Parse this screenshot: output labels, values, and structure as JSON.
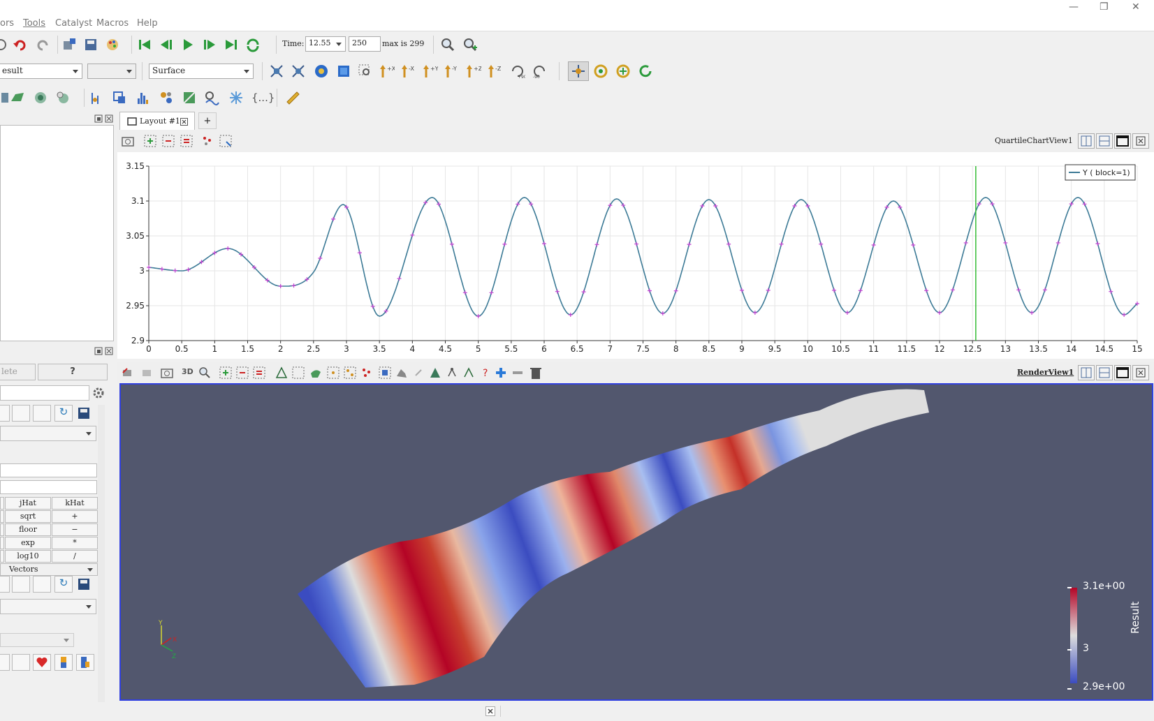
{
  "menubar": {
    "items": [
      {
        "label": "ors",
        "u": ""
      },
      {
        "label": "Tools",
        "u": "T"
      },
      {
        "label": "Catalyst",
        "u": "C"
      },
      {
        "label": "Macros",
        "u": "M"
      },
      {
        "label": "Help",
        "u": "H"
      }
    ],
    "window_controls": [
      "—",
      "❐",
      "✕"
    ]
  },
  "time_toolbar": {
    "time_label": "Time:",
    "time_value": "12.55",
    "step_value": "250",
    "max_label": "max is 299"
  },
  "representation_toolbar": {
    "array_combo": "esult",
    "component_combo": "",
    "representation": "Surface"
  },
  "layout_tab": {
    "label": "Layout #1",
    "add_label": "+"
  },
  "chart_view": {
    "name": "QuartileChartView1",
    "legend": "Y ( block=1)",
    "line_color": "#3c7a96",
    "marker_color": "#c040d0",
    "time_marker_color": "#33bb33",
    "time_marker_x": 12.55
  },
  "chart_data": {
    "type": "line",
    "title": "",
    "xlabel": "",
    "ylabel": "",
    "xlim": [
      0,
      15
    ],
    "ylim": [
      2.9,
      3.15
    ],
    "x_ticks": [
      "0",
      "0.5",
      "1",
      "1.5",
      "2",
      "2.5",
      "3",
      "3.5",
      "4",
      "4.5",
      "5",
      "5.5",
      "6",
      "6.5",
      "7",
      "7.5",
      "8",
      "8.5",
      "9",
      "9.5",
      "10",
      "10.5",
      "11",
      "11.5",
      "12",
      "12.5",
      "13",
      "13.5",
      "14",
      "14.5",
      "15"
    ],
    "y_ticks": [
      "2.9",
      "2.95",
      "3",
      "3.05",
      "3.1",
      "3.15"
    ],
    "grid": true,
    "legend_position": "top-right",
    "series": [
      {
        "name": "Y ( block=1)",
        "x": [
          0,
          0.5,
          1.2,
          2.0,
          2.5,
          2.95,
          3.5,
          4.3,
          5.0,
          5.7,
          6.4,
          7.1,
          7.8,
          8.5,
          9.2,
          9.9,
          10.6,
          11.3,
          12.0,
          12.7,
          13.4,
          14.1,
          14.8,
          15.0
        ],
        "y": [
          3.005,
          3.0,
          3.032,
          2.978,
          2.998,
          3.095,
          2.935,
          3.105,
          2.935,
          3.105,
          2.937,
          3.103,
          2.939,
          3.102,
          2.94,
          3.102,
          2.94,
          3.1,
          2.94,
          3.105,
          2.94,
          3.105,
          2.937,
          2.953
        ]
      }
    ]
  },
  "calculator": {
    "delete_label": "lete",
    "help_label": "?",
    "rows": [
      [
        "jHat",
        "kHat"
      ],
      [
        "sqrt",
        "+"
      ],
      [
        "floor",
        "−"
      ],
      [
        "exp",
        "*"
      ],
      [
        "log10",
        "/"
      ]
    ],
    "vectors_label": "Vectors"
  },
  "render_view": {
    "name": "RenderView1",
    "toolbar_3d_label": "3D",
    "background": "#52576e",
    "axes_labels": [
      "Y",
      "X",
      "Z"
    ]
  },
  "color_legend": {
    "title": "Result",
    "max_label": "3.1e+00",
    "mid_label": "3",
    "min_label": "2.9e+00",
    "high_color": "#b40426",
    "mid_color": "#dddddd",
    "low_color": "#3b4cc0"
  }
}
